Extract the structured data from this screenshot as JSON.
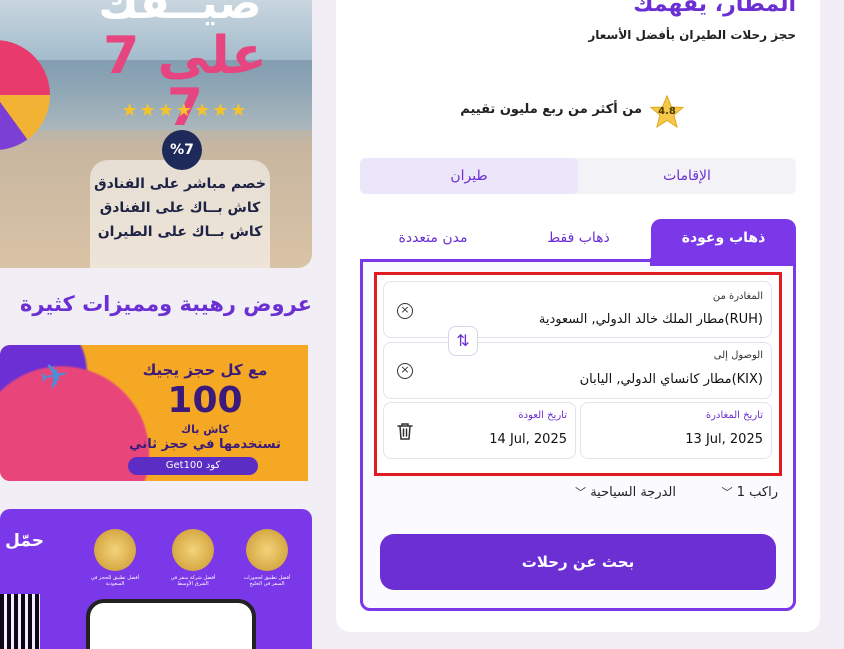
{
  "promo": {
    "headline": "صيــفك",
    "seven_on_seven": "7 على 7",
    "stars": "★★★★★★★",
    "discount_badge": "%7",
    "lines": [
      "خصم مباشر على الفنادق",
      "كاش بــاك على الفنادق",
      "كاش بــاك على الطيران"
    ]
  },
  "offers_section_title": "عروض رهيبة ومميزات كثيرة",
  "cashback_banner": {
    "line1": "مع كل حجز يجيك",
    "amount": "100",
    "cashback_label": "كاش باك",
    "line2": "تستخدمها في حجز ثاني",
    "code_label": "Get100 كود"
  },
  "app_banner": {
    "title": "حمّل",
    "award_texts": [
      "أفضل تطبيق لحجوزات السفر في الخليج",
      "أفضل شركة سفر في الشرق الأوسط",
      "أفضل تطبيق للحجز في السعودية"
    ]
  },
  "header": {
    "brand": "المطار، يفهمك",
    "tagline": "حجز رحلات الطيران بأفضل الأسعار"
  },
  "rating": {
    "score": "4.8",
    "text": "من أكثر من ربع مليون تقييم"
  },
  "service_tabs": {
    "flights": "طيران",
    "stays": "الإقامات"
  },
  "trip_tabs": {
    "round_trip": "ذهاب وعودة",
    "one_way": "ذهاب فقط",
    "multi_city": "مدن متعددة"
  },
  "form": {
    "from_label": "المغادرة من",
    "from_value": "مطار الملك خالد الدولي, السعودية(RUH)",
    "to_label": "الوصول إلى",
    "to_value": "مطار كانساي الدولي, اليابان(KIX)",
    "depart_label": "تاريخ المغادرة",
    "depart_value": "13 Jul, 2025",
    "return_label": "تاريخ العودة",
    "return_value": "14 Jul, 2025",
    "passengers": "1 راكب",
    "cabin": "الدرجة السياحية",
    "search_button": "بحث عن رحلات"
  },
  "colors": {
    "brand_purple": "#6b2fd3",
    "accent_purple": "#7a38e8",
    "highlight_red": "#e11b22"
  }
}
